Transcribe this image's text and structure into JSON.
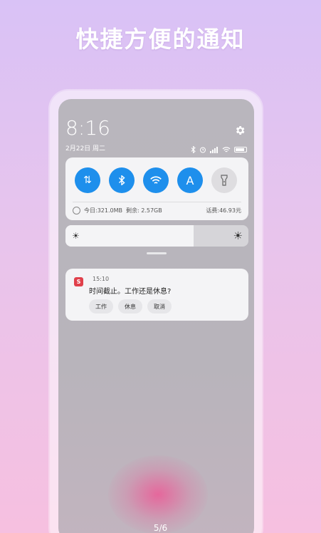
{
  "headline": "快捷方便的通知",
  "status_bar": {
    "time": "8:16",
    "date": "2月22日 周二",
    "icons": [
      "bluetooth-icon",
      "alarm-icon",
      "signal-icon",
      "wifi-icon",
      "battery-icon"
    ]
  },
  "quick_settings": {
    "toggles": [
      {
        "name": "mobile-data",
        "icon": "⇅",
        "on": true
      },
      {
        "name": "bluetooth",
        "icon": "✱",
        "on": true
      },
      {
        "name": "wifi",
        "icon": "wifi",
        "on": true
      },
      {
        "name": "auto-brightness",
        "icon": "A",
        "on": true
      },
      {
        "name": "flashlight",
        "icon": "flashlight",
        "on": false
      }
    ],
    "data_usage": {
      "today": "今日:321.0MB",
      "remaining": "剩余: 2.57GB",
      "balance": "话费:46.93元"
    }
  },
  "brightness": {
    "level": 0.7,
    "low_icon": "☀",
    "high_icon": "☀"
  },
  "notification": {
    "time": "15:10",
    "message": "时间截止。工作还是休息?",
    "actions": [
      "工作",
      "休息",
      "取消"
    ]
  },
  "page_indicator": "5/6"
}
